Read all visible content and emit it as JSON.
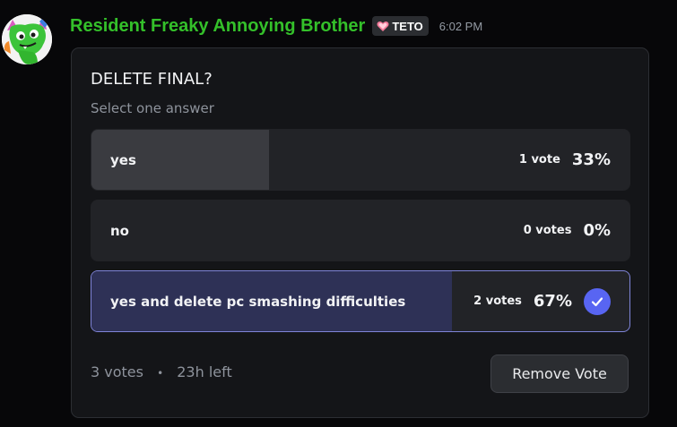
{
  "message": {
    "username": "Resident Freaky Annoying Brother",
    "tag": {
      "icon": "heart-icon",
      "label": "TETO"
    },
    "timestamp": "6:02 PM",
    "avatar_icon": "green-cat-avatar"
  },
  "colors": {
    "username": "#34c02a",
    "accent": "#5865f2",
    "selected_border": "#7f84d8",
    "heart": "#f47b9a"
  },
  "poll": {
    "question": "DELETE FINAL?",
    "prompt": "Select one answer",
    "answers": [
      {
        "label": "yes",
        "votes": "1 vote",
        "percent": "33%",
        "fraction": 0.33,
        "selected": false
      },
      {
        "label": "no",
        "votes": "0 votes",
        "percent": "0%",
        "fraction": 0.0,
        "selected": false
      },
      {
        "label": "yes and delete pc smashing difficulties",
        "votes": "2 votes",
        "percent": "67%",
        "fraction": 0.67,
        "selected": true,
        "check_icon": "checkmark-icon"
      }
    ],
    "footer": {
      "total": "3 votes",
      "separator": "•",
      "time_left": "23h left"
    },
    "remove_vote_label": "Remove Vote"
  }
}
